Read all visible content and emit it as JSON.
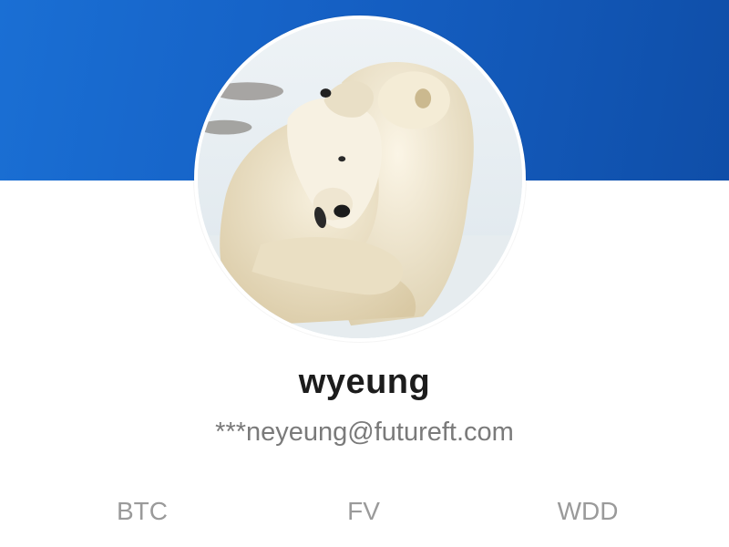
{
  "profile": {
    "username": "wyeung",
    "email": "***neyeung@futureft.com",
    "avatar_icon": "polar-bears-photo"
  },
  "stats": [
    {
      "label": "BTC"
    },
    {
      "label": "FV"
    },
    {
      "label": "WDD"
    }
  ],
  "colors": {
    "banner_start": "#1a6fd4",
    "banner_end": "#0f4ea8",
    "username": "#1c1c1c",
    "email": "#7a7a7a",
    "stat_label": "#9a9a9a"
  }
}
